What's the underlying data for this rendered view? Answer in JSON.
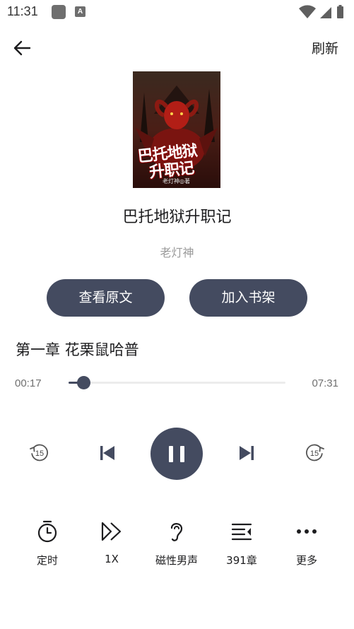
{
  "status_bar": {
    "time": "11:31",
    "a_badge": "A"
  },
  "header": {
    "refresh_label": "刷新"
  },
  "book": {
    "cover_title_line1": "巴托地狱",
    "cover_title_line2": "升职记",
    "cover_author": "老灯神◎著",
    "title": "巴托地狱升职记",
    "author": "老灯神"
  },
  "actions": {
    "view_original": "查看原文",
    "add_to_shelf": "加入书架"
  },
  "player": {
    "chapter": "第一章 花栗鼠哈普",
    "current_time": "00:17",
    "total_time": "07:31",
    "progress": 0.068,
    "rewind_seconds": "15",
    "forward_seconds": "15",
    "state": "playing"
  },
  "toolbar": {
    "timer": "定时",
    "speed": "1X",
    "voice": "磁性男声",
    "chapters": "391章",
    "more": "更多"
  },
  "colors": {
    "accent": "#444b60",
    "muted_text": "#9a9a9a"
  }
}
